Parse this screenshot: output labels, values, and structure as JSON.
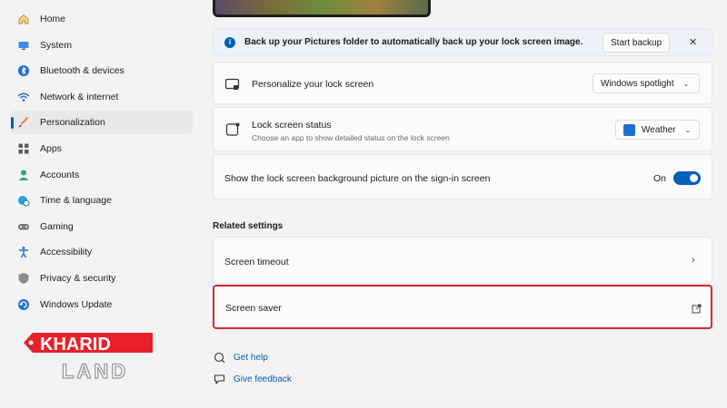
{
  "sidebar": {
    "items": [
      {
        "label": "Home",
        "icon": "home-icon"
      },
      {
        "label": "System",
        "icon": "monitor-icon"
      },
      {
        "label": "Bluetooth & devices",
        "icon": "bluetooth-icon"
      },
      {
        "label": "Network & internet",
        "icon": "wifi-icon"
      },
      {
        "label": "Personalization",
        "icon": "brush-icon",
        "active": true
      },
      {
        "label": "Apps",
        "icon": "apps-icon"
      },
      {
        "label": "Accounts",
        "icon": "person-icon"
      },
      {
        "label": "Time & language",
        "icon": "globe-clock-icon"
      },
      {
        "label": "Gaming",
        "icon": "controller-icon"
      },
      {
        "label": "Accessibility",
        "icon": "accessibility-icon"
      },
      {
        "label": "Privacy & security",
        "icon": "shield-icon"
      },
      {
        "label": "Windows Update",
        "icon": "update-icon"
      }
    ]
  },
  "banner": {
    "message": "Back up your Pictures folder to automatically back up your lock screen image.",
    "action_label": "Start backup",
    "close_glyph": "✕"
  },
  "settings": {
    "personalize": {
      "title": "Personalize your lock screen",
      "value": "Windows spotlight"
    },
    "status": {
      "title": "Lock screen status",
      "subtitle": "Choose an app to show detailed status on the lock screen",
      "value": "Weather"
    },
    "signin": {
      "title": "Show the lock screen background picture on the sign-in screen",
      "state_label": "On",
      "enabled": true
    }
  },
  "related": {
    "heading": "Related settings",
    "timeout": {
      "title": "Screen timeout"
    },
    "saver": {
      "title": "Screen saver"
    }
  },
  "help_links": {
    "get_help": "Get help",
    "feedback": "Give feedback"
  },
  "logo": {
    "top": "KHARID",
    "bottom": "LAND"
  },
  "colors": {
    "accent": "#005fb8",
    "highlight": "#d02a35",
    "logo_red": "#e8202a"
  }
}
